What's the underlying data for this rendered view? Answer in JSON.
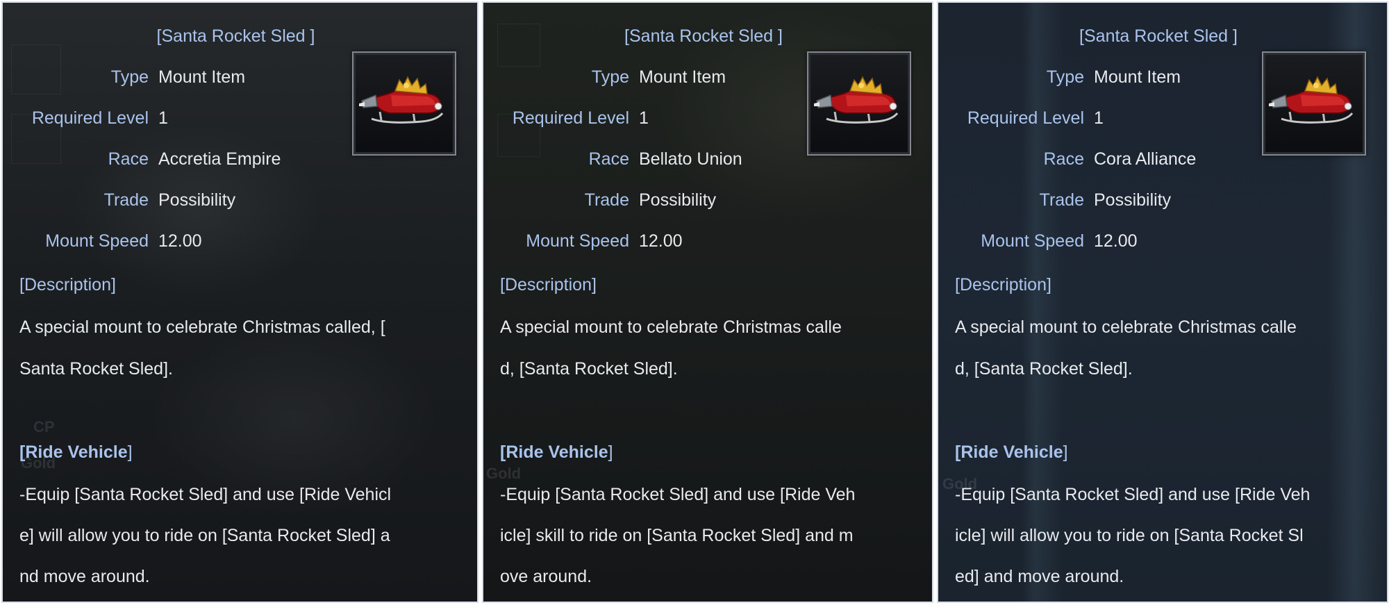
{
  "panels": [
    {
      "title": "[Santa Rocket Sled ]",
      "rows": [
        {
          "label": "Type",
          "value": "Mount Item"
        },
        {
          "label": "Required Level",
          "value": "1"
        },
        {
          "label": "Race",
          "value": "Accretia Empire"
        },
        {
          "label": "Trade",
          "value": "Possibility"
        },
        {
          "label": "Mount Speed",
          "value": "12.00"
        }
      ],
      "description_head": "[Description]",
      "description_lines": [
        "A special mount to celebrate Christmas called, [",
        "Santa Rocket Sled]."
      ],
      "ride_head": "[Ride Vehicle",
      "ride_head_close": "]",
      "ride_lines": [
        "-Equip [Santa Rocket Sled] and use [Ride Vehicl",
        "e] will allow you to ride on [Santa Rocket Sled] a",
        "nd move around."
      ],
      "background_texts": [
        "CP",
        "Gold"
      ]
    },
    {
      "title": "[Santa Rocket Sled ]",
      "rows": [
        {
          "label": "Type",
          "value": "Mount Item"
        },
        {
          "label": "Required Level",
          "value": "1"
        },
        {
          "label": "Race",
          "value": "Bellato Union"
        },
        {
          "label": "Trade",
          "value": "Possibility"
        },
        {
          "label": "Mount Speed",
          "value": "12.00"
        }
      ],
      "description_head": "[Description]",
      "description_lines": [
        "A special mount to celebrate Christmas calle",
        "d, [Santa Rocket Sled]."
      ],
      "ride_head": "[Ride Vehicle",
      "ride_head_close": "]",
      "ride_lines": [
        "-Equip [Santa Rocket Sled] and use [Ride Veh",
        "icle] skill to ride on [Santa Rocket Sled] and m",
        "ove around."
      ],
      "background_texts": [
        "Gold"
      ]
    },
    {
      "title": "[Santa Rocket Sled ]",
      "rows": [
        {
          "label": "Type",
          "value": "Mount Item"
        },
        {
          "label": "Required Level",
          "value": "1"
        },
        {
          "label": "Race",
          "value": "Cora Alliance"
        },
        {
          "label": "Trade",
          "value": "Possibility"
        },
        {
          "label": "Mount Speed",
          "value": "12.00"
        }
      ],
      "description_head": "[Description]",
      "description_lines": [
        "A special mount to celebrate Christmas calle",
        "d, [Santa Rocket Sled]."
      ],
      "ride_head": "[Ride Vehicle",
      "ride_head_close": "]",
      "ride_lines": [
        "-Equip [Santa Rocket Sled] and use [Ride Veh",
        "icle] will allow you to ride on [Santa Rocket Sl",
        "ed] and move around."
      ],
      "background_texts": [
        "Gold"
      ]
    }
  ],
  "item_icon": "santa-rocket-sled-icon",
  "colors": {
    "label": "#aac3ec",
    "value": "#e8eaee",
    "panel_border": "#d6dbe6"
  }
}
